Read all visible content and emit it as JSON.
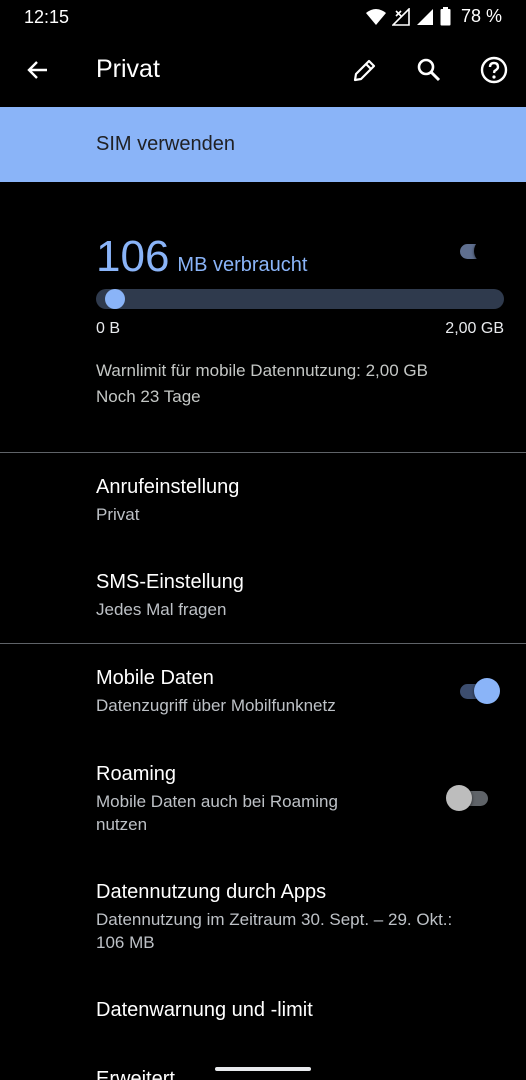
{
  "status": {
    "time": "12:15",
    "battery": "78 %"
  },
  "appbar": {
    "title": "Privat"
  },
  "sim": {
    "label": "SIM verwenden",
    "enabled": true
  },
  "usage": {
    "amount": "106",
    "unit": "MB verbraucht",
    "progress_fraction": 0.05,
    "min_label": "0 B",
    "max_label": "2,00 GB",
    "warning": "Warnlimit für mobile Datennutzung: 2,00 GB",
    "remaining": "Noch 23 Tage"
  },
  "calls": {
    "title": "Anrufeinstellung",
    "value": "Privat"
  },
  "sms": {
    "title": "SMS-Einstellung",
    "value": "Jedes Mal fragen"
  },
  "mobile_data": {
    "title": "Mobile Daten",
    "subtitle": "Datenzugriff über Mobilfunknetz",
    "enabled": true
  },
  "roaming": {
    "title": "Roaming",
    "subtitle_line1": "Mobile Daten auch bei Roaming",
    "subtitle_line2": "nutzen",
    "enabled": false
  },
  "app_usage": {
    "title": "Datennutzung durch Apps",
    "subtitle_line1": "Datennutzung im Zeitraum 30. Sept. – 29. Okt.:",
    "subtitle_line2": "106 MB"
  },
  "data_warning": {
    "title": "Datenwarnung und -limit"
  },
  "advanced": {
    "title": "Erweitert"
  },
  "colors": {
    "accent": "#8ab4f8",
    "background": "#000000",
    "banner": "#8ab4f8"
  },
  "icons": [
    "back-arrow-icon",
    "edit-pencil-icon",
    "search-icon",
    "help-icon",
    "wifi-icon",
    "signal-icon",
    "battery-icon"
  ]
}
